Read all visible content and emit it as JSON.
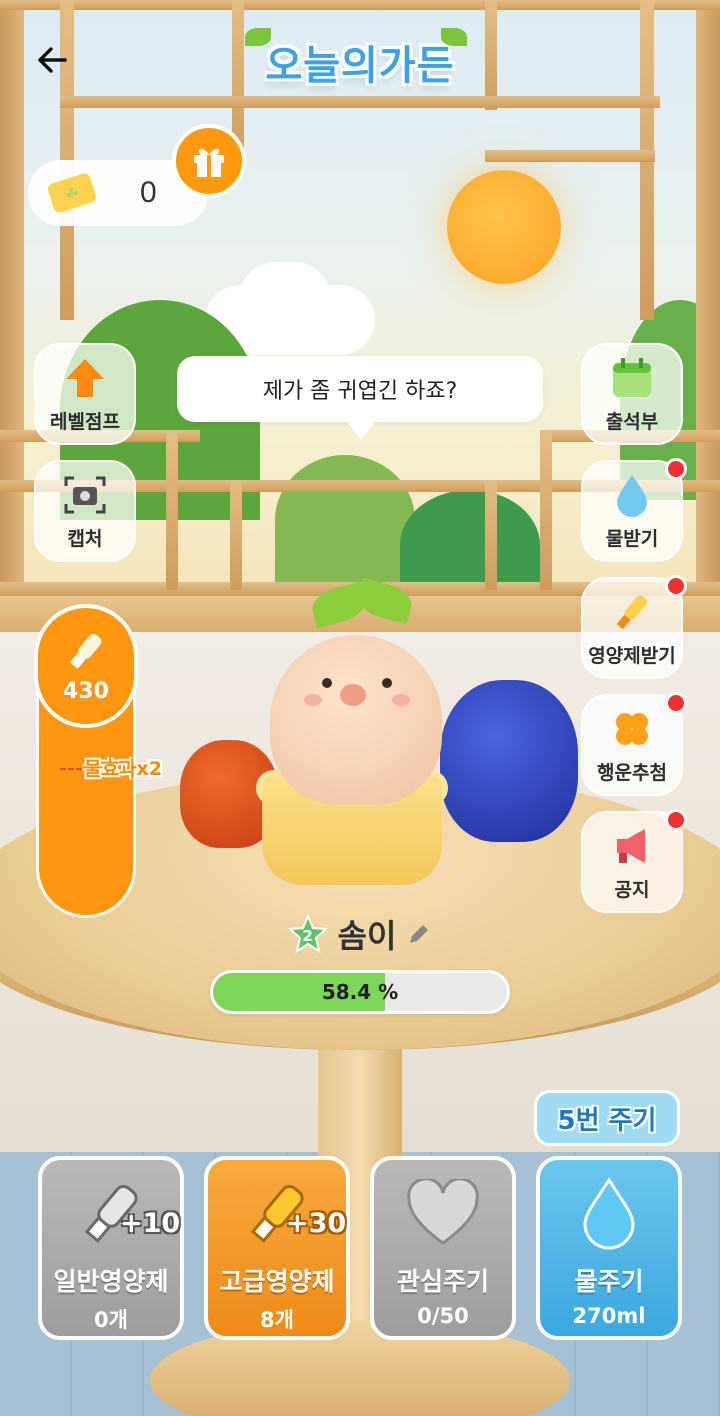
{
  "header": {
    "back_icon": "arrow-left-icon",
    "logo_text": "오늘의가든"
  },
  "tickets": {
    "icon": "clover-ticket-icon",
    "count": "0"
  },
  "gift": {
    "icon": "gift-icon"
  },
  "left_buttons": [
    {
      "label": "레벨점프",
      "icon": "arrow-up-icon"
    },
    {
      "label": "캡처",
      "icon": "camera-icon"
    }
  ],
  "right_buttons": [
    {
      "label": "출석부",
      "icon": "calendar-icon",
      "badge": false
    },
    {
      "label": "물받기",
      "icon": "water-drop-icon",
      "badge": true
    },
    {
      "label": "영양제받기",
      "icon": "nutrient-bottle-icon",
      "badge": true
    },
    {
      "label": "행운추첨",
      "icon": "clover-icon",
      "badge": true
    },
    {
      "label": "공지",
      "icon": "megaphone-icon",
      "badge": true
    }
  ],
  "speech": "제가 좀 귀엽긴 하죠?",
  "gauge": {
    "value": "430",
    "mark_label": "물효과x2",
    "icon": "bottle-icon"
  },
  "pet": {
    "level": "2",
    "name": "솜이",
    "edit_icon": "pencil-icon"
  },
  "progress": {
    "percent": 58.4,
    "label": "58.4 %"
  },
  "water_count_badge": "5번 주기",
  "actions": [
    {
      "label": "일반영양제",
      "sub": "0개",
      "bonus": "+10",
      "icon": "bottle-icon",
      "color": "#a9a9a9"
    },
    {
      "label": "고급영양제",
      "sub": "8개",
      "bonus": "+30",
      "icon": "gold-bottle-icon",
      "color": "#f39a26"
    },
    {
      "label": "관심주기",
      "sub": "0/50",
      "icon": "heart-icon",
      "color": "#a9a9a9"
    },
    {
      "label": "물주기",
      "sub": "270ml",
      "icon": "water-drop-icon",
      "color": "#4db3e6"
    }
  ],
  "colors": {
    "accent_orange": "#ff9510",
    "progress_green": "#7ed65a",
    "badge_red": "#ef3030",
    "water_blue": "#3aa8df"
  }
}
